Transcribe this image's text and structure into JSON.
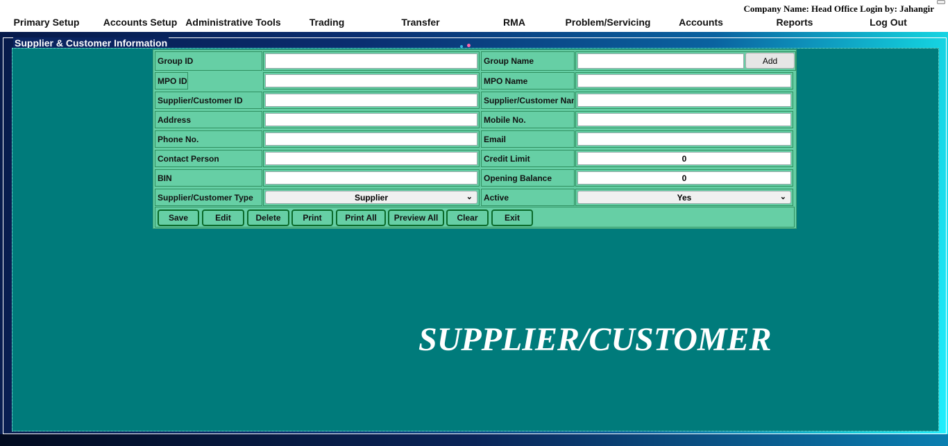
{
  "header": {
    "company_text": "Company Name: Head Office Login by: Jahangir",
    "menu": [
      {
        "label": "Primary Setup"
      },
      {
        "label": "Accounts Setup"
      },
      {
        "label": "Administrative Tools"
      },
      {
        "label": "Trading"
      },
      {
        "label": "Transfer"
      },
      {
        "label": "RMA"
      },
      {
        "label": "Problem/Servicing"
      },
      {
        "label": "Accounts"
      },
      {
        "label": "Reports"
      },
      {
        "label": "Log Out"
      }
    ]
  },
  "section": {
    "title": "Supplier & Customer Information"
  },
  "form": {
    "left": [
      {
        "label": "Group ID",
        "value": ""
      },
      {
        "label": "MPO ID",
        "value": ""
      },
      {
        "label": "Supplier/Customer ID",
        "value": ""
      },
      {
        "label": "Address",
        "value": ""
      },
      {
        "label": "Phone No.",
        "value": ""
      },
      {
        "label": "Contact Person",
        "value": ""
      },
      {
        "label": "BIN",
        "value": ""
      },
      {
        "label": "Supplier/Customer Type",
        "value": "Supplier"
      }
    ],
    "right": [
      {
        "label": "Group Name",
        "value": ""
      },
      {
        "label": "MPO Name",
        "value": ""
      },
      {
        "label": "Supplier/Customer Name",
        "value": ""
      },
      {
        "label": "Mobile No.",
        "value": ""
      },
      {
        "label": "Email",
        "value": ""
      },
      {
        "label": "Credit Limit",
        "value": "0"
      },
      {
        "label": "Opening Balance",
        "value": "0"
      },
      {
        "label": "Active",
        "value": "Yes"
      }
    ],
    "add_label": "Add",
    "buttons": {
      "save": "Save",
      "edit": "Edit",
      "delete": "Delete",
      "print": "Print",
      "print_all": "Print All",
      "preview_all": "Preview All",
      "clear": "Clear",
      "exit": "Exit"
    }
  },
  "watermark": "SUPPLIER/CUSTOMER",
  "colors": {
    "panel": "#007b7b",
    "form": "#66cfa5",
    "button_border": "#0a6a2a"
  }
}
